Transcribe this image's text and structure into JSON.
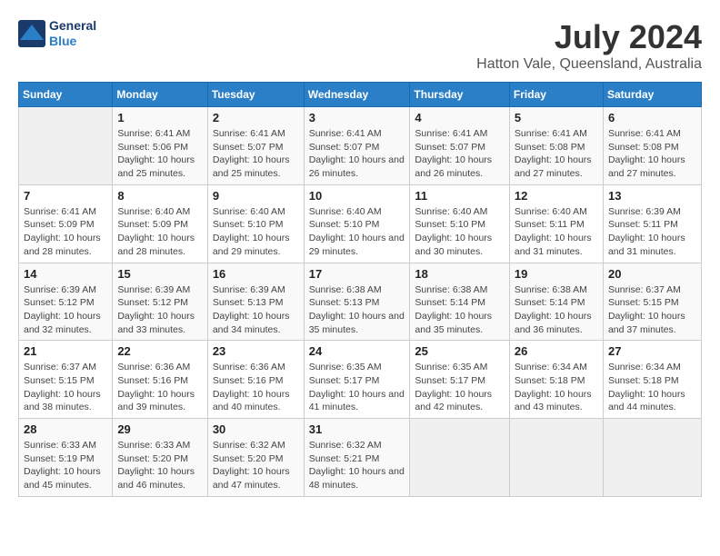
{
  "logo": {
    "line1": "General",
    "line2": "Blue"
  },
  "title": "July 2024",
  "location": "Hatton Vale, Queensland, Australia",
  "headers": [
    "Sunday",
    "Monday",
    "Tuesday",
    "Wednesday",
    "Thursday",
    "Friday",
    "Saturday"
  ],
  "weeks": [
    [
      {
        "day": "",
        "sunrise": "",
        "sunset": "",
        "daylight": ""
      },
      {
        "day": "1",
        "sunrise": "Sunrise: 6:41 AM",
        "sunset": "Sunset: 5:06 PM",
        "daylight": "Daylight: 10 hours and 25 minutes."
      },
      {
        "day": "2",
        "sunrise": "Sunrise: 6:41 AM",
        "sunset": "Sunset: 5:07 PM",
        "daylight": "Daylight: 10 hours and 25 minutes."
      },
      {
        "day": "3",
        "sunrise": "Sunrise: 6:41 AM",
        "sunset": "Sunset: 5:07 PM",
        "daylight": "Daylight: 10 hours and 26 minutes."
      },
      {
        "day": "4",
        "sunrise": "Sunrise: 6:41 AM",
        "sunset": "Sunset: 5:07 PM",
        "daylight": "Daylight: 10 hours and 26 minutes."
      },
      {
        "day": "5",
        "sunrise": "Sunrise: 6:41 AM",
        "sunset": "Sunset: 5:08 PM",
        "daylight": "Daylight: 10 hours and 27 minutes."
      },
      {
        "day": "6",
        "sunrise": "Sunrise: 6:41 AM",
        "sunset": "Sunset: 5:08 PM",
        "daylight": "Daylight: 10 hours and 27 minutes."
      }
    ],
    [
      {
        "day": "7",
        "sunrise": "Sunrise: 6:41 AM",
        "sunset": "Sunset: 5:09 PM",
        "daylight": "Daylight: 10 hours and 28 minutes."
      },
      {
        "day": "8",
        "sunrise": "Sunrise: 6:40 AM",
        "sunset": "Sunset: 5:09 PM",
        "daylight": "Daylight: 10 hours and 28 minutes."
      },
      {
        "day": "9",
        "sunrise": "Sunrise: 6:40 AM",
        "sunset": "Sunset: 5:10 PM",
        "daylight": "Daylight: 10 hours and 29 minutes."
      },
      {
        "day": "10",
        "sunrise": "Sunrise: 6:40 AM",
        "sunset": "Sunset: 5:10 PM",
        "daylight": "Daylight: 10 hours and 29 minutes."
      },
      {
        "day": "11",
        "sunrise": "Sunrise: 6:40 AM",
        "sunset": "Sunset: 5:10 PM",
        "daylight": "Daylight: 10 hours and 30 minutes."
      },
      {
        "day": "12",
        "sunrise": "Sunrise: 6:40 AM",
        "sunset": "Sunset: 5:11 PM",
        "daylight": "Daylight: 10 hours and 31 minutes."
      },
      {
        "day": "13",
        "sunrise": "Sunrise: 6:39 AM",
        "sunset": "Sunset: 5:11 PM",
        "daylight": "Daylight: 10 hours and 31 minutes."
      }
    ],
    [
      {
        "day": "14",
        "sunrise": "Sunrise: 6:39 AM",
        "sunset": "Sunset: 5:12 PM",
        "daylight": "Daylight: 10 hours and 32 minutes."
      },
      {
        "day": "15",
        "sunrise": "Sunrise: 6:39 AM",
        "sunset": "Sunset: 5:12 PM",
        "daylight": "Daylight: 10 hours and 33 minutes."
      },
      {
        "day": "16",
        "sunrise": "Sunrise: 6:39 AM",
        "sunset": "Sunset: 5:13 PM",
        "daylight": "Daylight: 10 hours and 34 minutes."
      },
      {
        "day": "17",
        "sunrise": "Sunrise: 6:38 AM",
        "sunset": "Sunset: 5:13 PM",
        "daylight": "Daylight: 10 hours and 35 minutes."
      },
      {
        "day": "18",
        "sunrise": "Sunrise: 6:38 AM",
        "sunset": "Sunset: 5:14 PM",
        "daylight": "Daylight: 10 hours and 35 minutes."
      },
      {
        "day": "19",
        "sunrise": "Sunrise: 6:38 AM",
        "sunset": "Sunset: 5:14 PM",
        "daylight": "Daylight: 10 hours and 36 minutes."
      },
      {
        "day": "20",
        "sunrise": "Sunrise: 6:37 AM",
        "sunset": "Sunset: 5:15 PM",
        "daylight": "Daylight: 10 hours and 37 minutes."
      }
    ],
    [
      {
        "day": "21",
        "sunrise": "Sunrise: 6:37 AM",
        "sunset": "Sunset: 5:15 PM",
        "daylight": "Daylight: 10 hours and 38 minutes."
      },
      {
        "day": "22",
        "sunrise": "Sunrise: 6:36 AM",
        "sunset": "Sunset: 5:16 PM",
        "daylight": "Daylight: 10 hours and 39 minutes."
      },
      {
        "day": "23",
        "sunrise": "Sunrise: 6:36 AM",
        "sunset": "Sunset: 5:16 PM",
        "daylight": "Daylight: 10 hours and 40 minutes."
      },
      {
        "day": "24",
        "sunrise": "Sunrise: 6:35 AM",
        "sunset": "Sunset: 5:17 PM",
        "daylight": "Daylight: 10 hours and 41 minutes."
      },
      {
        "day": "25",
        "sunrise": "Sunrise: 6:35 AM",
        "sunset": "Sunset: 5:17 PM",
        "daylight": "Daylight: 10 hours and 42 minutes."
      },
      {
        "day": "26",
        "sunrise": "Sunrise: 6:34 AM",
        "sunset": "Sunset: 5:18 PM",
        "daylight": "Daylight: 10 hours and 43 minutes."
      },
      {
        "day": "27",
        "sunrise": "Sunrise: 6:34 AM",
        "sunset": "Sunset: 5:18 PM",
        "daylight": "Daylight: 10 hours and 44 minutes."
      }
    ],
    [
      {
        "day": "28",
        "sunrise": "Sunrise: 6:33 AM",
        "sunset": "Sunset: 5:19 PM",
        "daylight": "Daylight: 10 hours and 45 minutes."
      },
      {
        "day": "29",
        "sunrise": "Sunrise: 6:33 AM",
        "sunset": "Sunset: 5:20 PM",
        "daylight": "Daylight: 10 hours and 46 minutes."
      },
      {
        "day": "30",
        "sunrise": "Sunrise: 6:32 AM",
        "sunset": "Sunset: 5:20 PM",
        "daylight": "Daylight: 10 hours and 47 minutes."
      },
      {
        "day": "31",
        "sunrise": "Sunrise: 6:32 AM",
        "sunset": "Sunset: 5:21 PM",
        "daylight": "Daylight: 10 hours and 48 minutes."
      },
      {
        "day": "",
        "sunrise": "",
        "sunset": "",
        "daylight": ""
      },
      {
        "day": "",
        "sunrise": "",
        "sunset": "",
        "daylight": ""
      },
      {
        "day": "",
        "sunrise": "",
        "sunset": "",
        "daylight": ""
      }
    ]
  ]
}
